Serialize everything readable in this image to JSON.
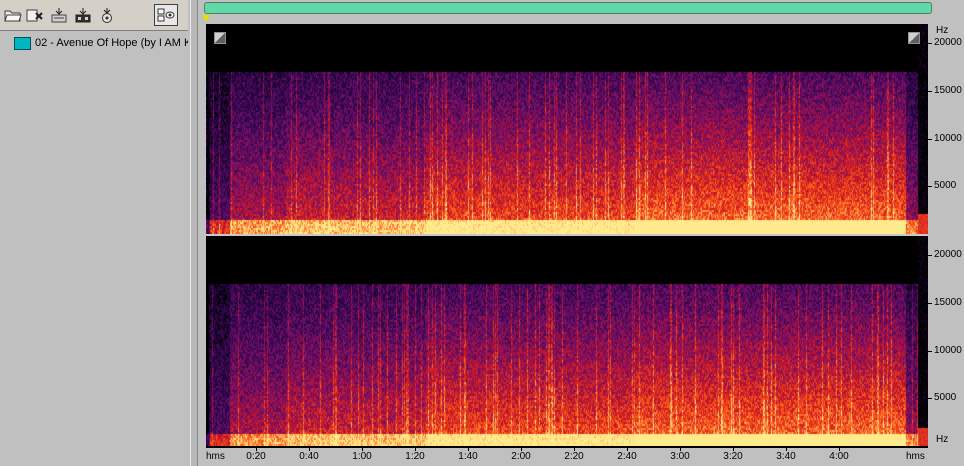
{
  "toolbar": {
    "buttons": [
      {
        "icon": "open-folder-icon"
      },
      {
        "icon": "close-file-icon"
      },
      {
        "icon": "insert-icon"
      },
      {
        "icon": "mix-icon"
      },
      {
        "icon": "record-icon"
      },
      {
        "icon": "view-options-icon"
      }
    ]
  },
  "files": [
    {
      "label": "02 - Avenue Of Hope (by I AM KI"
    }
  ],
  "spectrogram": {
    "freq_axis": {
      "unit": "Hz",
      "ticks": [
        "20000",
        "15000",
        "10000",
        "5000"
      ],
      "bottom_unit": "Hz"
    },
    "time_axis": {
      "start_label": "hms",
      "end_label": "hms",
      "ticks": [
        "0:20",
        "0:40",
        "1:00",
        "1:20",
        "1:40",
        "2:00",
        "2:20",
        "2:40",
        "3:00",
        "3:20",
        "3:40",
        "4:00"
      ]
    },
    "colors": {
      "low": "#000000",
      "mid_low": "#3a0a5a",
      "mid": "#c01028",
      "high": "#ff7010",
      "peak": "#ffe880"
    }
  }
}
